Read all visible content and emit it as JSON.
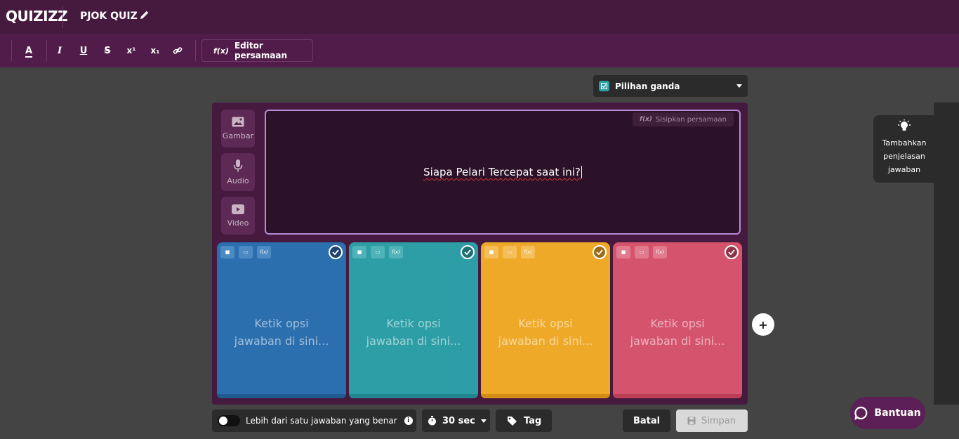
{
  "header": {
    "logo": "QUIZIZZ",
    "quiz_title": "PJOK QUIZ"
  },
  "toolbar": {
    "buttons": [
      "A",
      "I",
      "U",
      "S",
      "x¹",
      "x₁"
    ],
    "equation_editor_label": "Editor persamaan"
  },
  "question_type": {
    "selected": "Pilihan ganda"
  },
  "media": {
    "image_label": "Gambar",
    "audio_label": "Audio",
    "video_label": "Video"
  },
  "question": {
    "insert_equation_label": "Sisipkan persamaan",
    "text": "Siapa Pelari Tercepat saat ini?"
  },
  "answers": [
    {
      "placeholder_line1": "Ketik opsi",
      "placeholder_line2": "jawaban di sini...",
      "color": "#2c6fae"
    },
    {
      "placeholder_line1": "Ketik opsi",
      "placeholder_line2": "jawaban di sini...",
      "color": "#2d9da6"
    },
    {
      "placeholder_line1": "Ketik opsi",
      "placeholder_line2": "jawaban di sini...",
      "color": "#efa929"
    },
    {
      "placeholder_line1": "Ketik opsi",
      "placeholder_line2": "jawaban di sini...",
      "color": "#d5546d"
    }
  ],
  "footer": {
    "multi_correct_label": "Lebih dari satu jawaban yang benar",
    "timer_label": "30 sec",
    "tag_label": "Tag",
    "cancel_label": "Batal",
    "save_label": "Simpan"
  },
  "side": {
    "explain_line1": "Tambahkan",
    "explain_line2": "penjelasan",
    "explain_line3": "jawaban"
  },
  "help": {
    "label": "Bantuan"
  }
}
